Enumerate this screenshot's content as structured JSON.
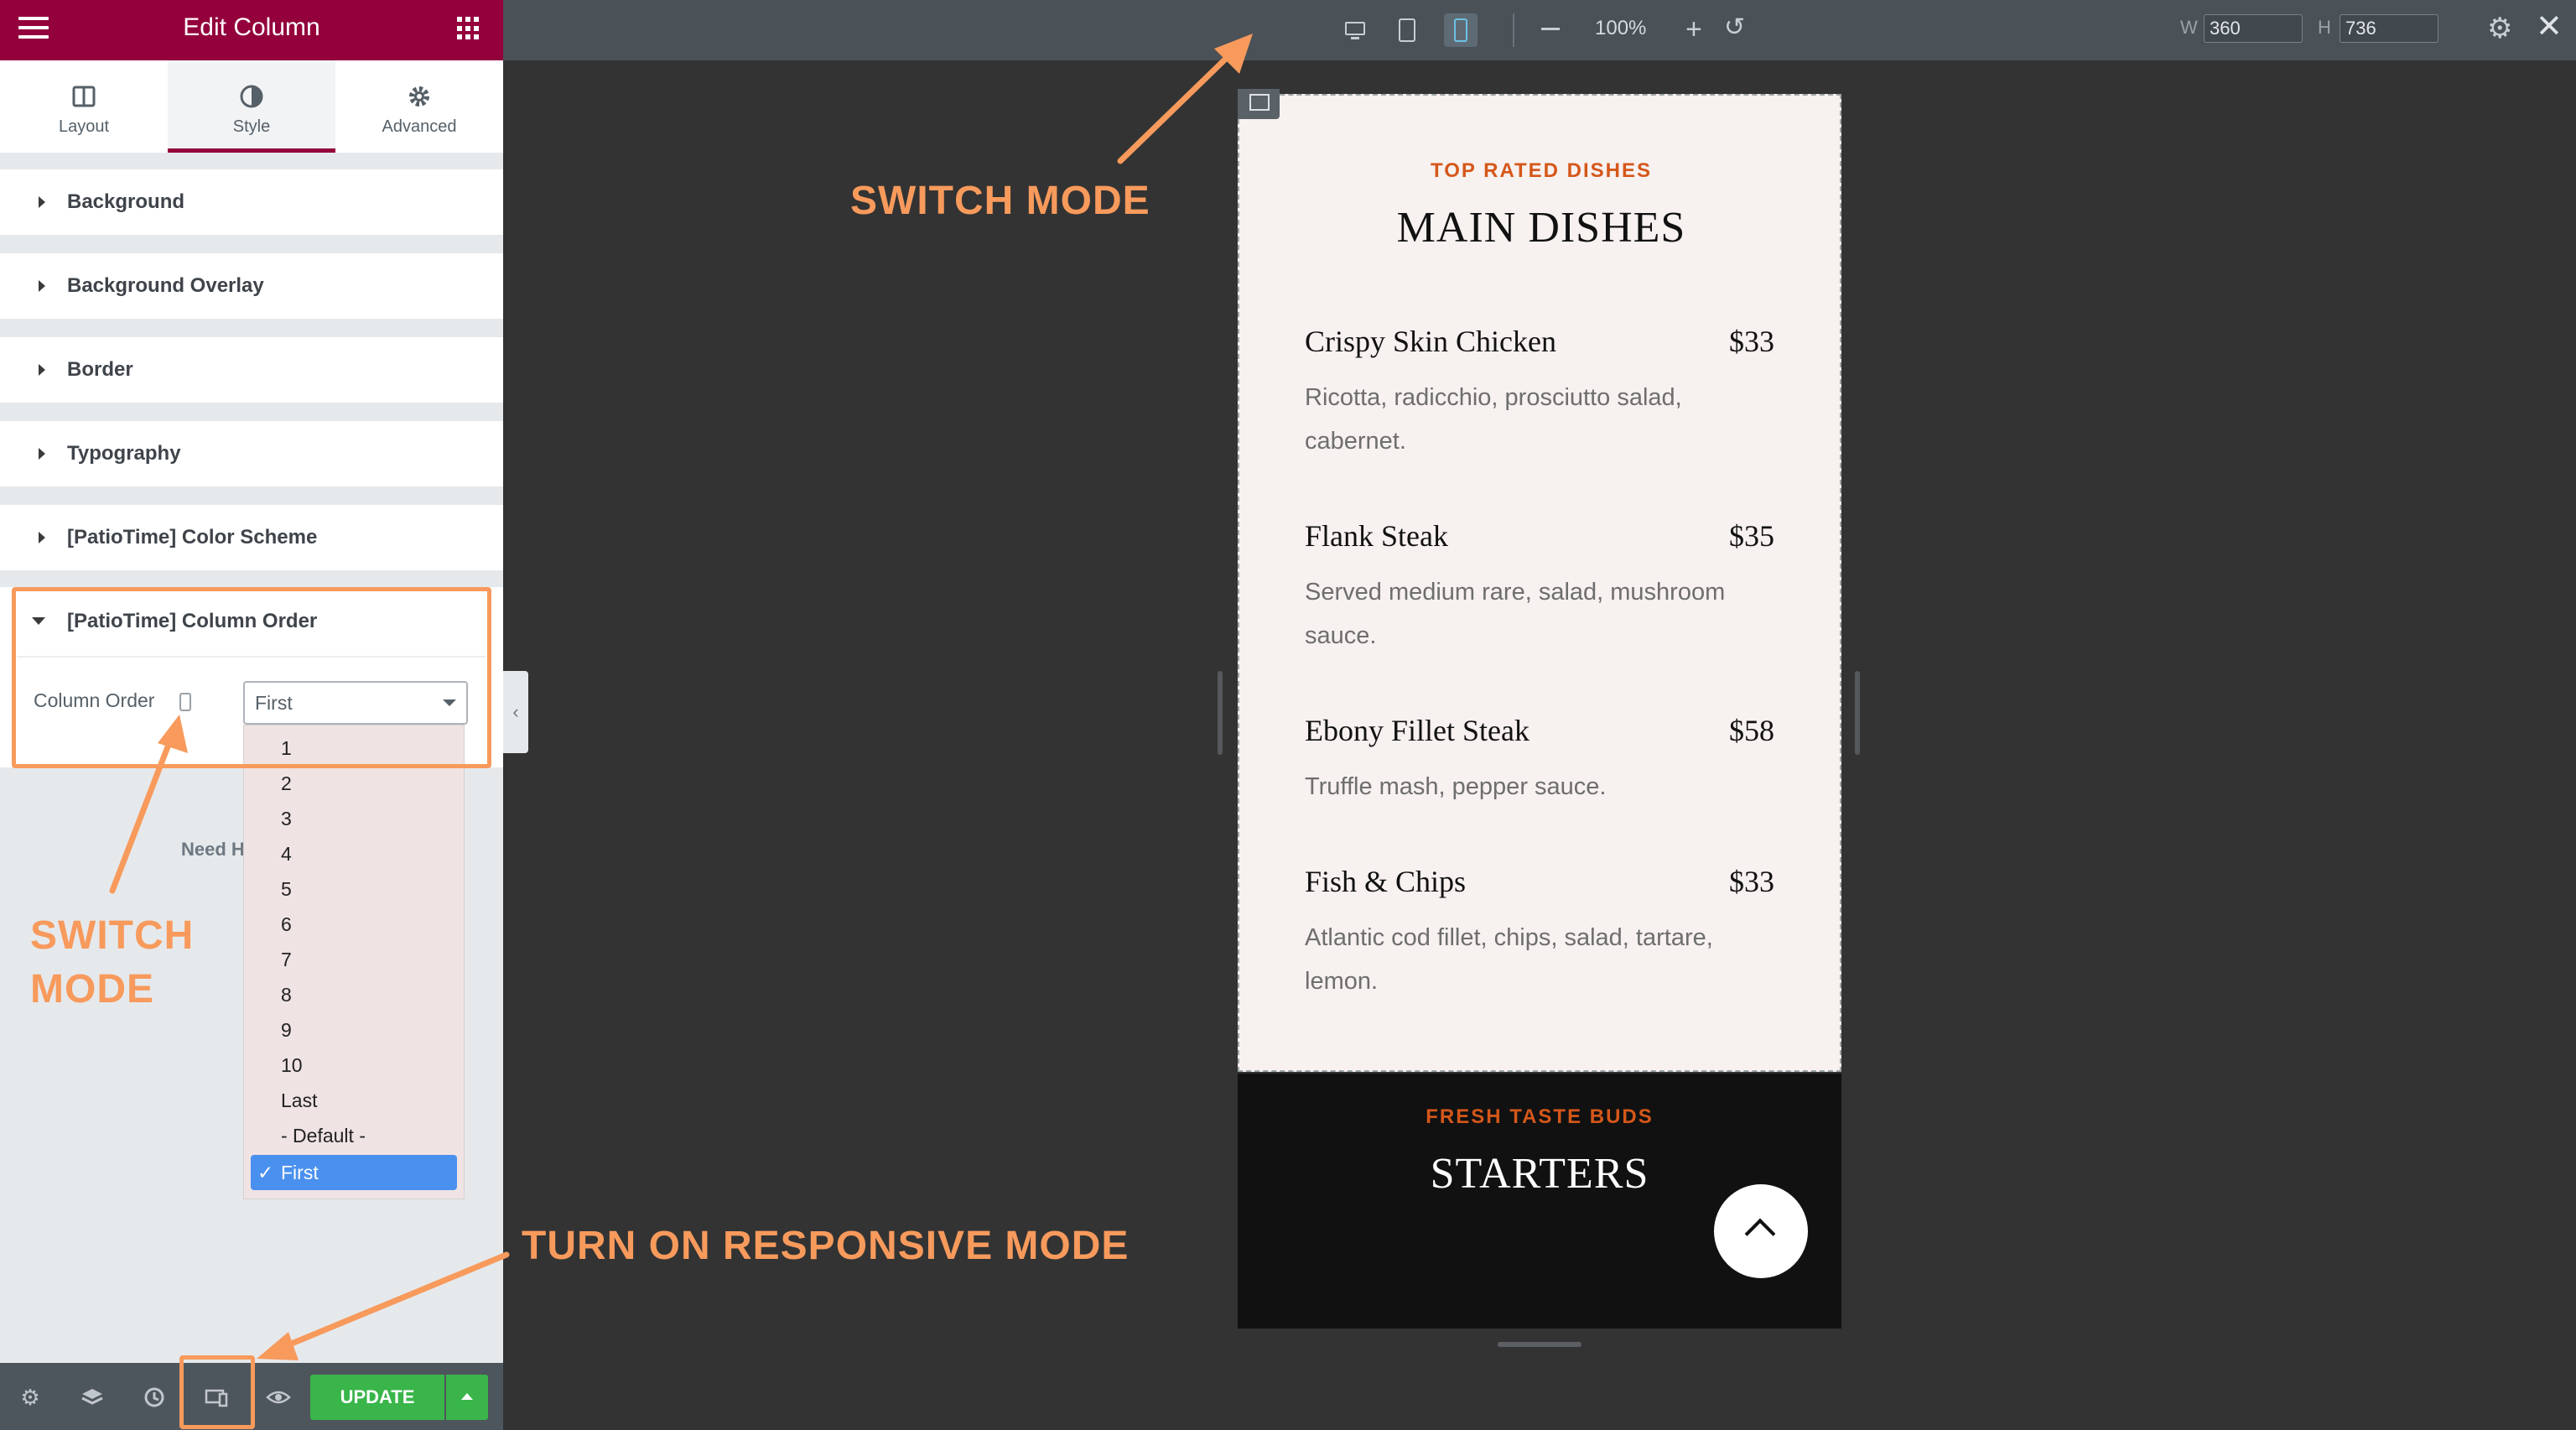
{
  "panel": {
    "title": "Edit Column",
    "tabs": [
      {
        "label": "Layout",
        "icon": "columns-icon"
      },
      {
        "label": "Style",
        "icon": "contrast-icon"
      },
      {
        "label": "Advanced",
        "icon": "gear-icon"
      }
    ],
    "active_tab": "Style",
    "sections": [
      {
        "label": "Background"
      },
      {
        "label": "Background Overlay"
      },
      {
        "label": "Border"
      },
      {
        "label": "Typography"
      },
      {
        "label": "[PatioTime] Color Scheme"
      }
    ],
    "open_section": {
      "label": "[PatioTime] Column Order",
      "field_label": "Column Order",
      "selected": "First"
    },
    "need_help": "Need H",
    "dropdown_options": [
      "1",
      "2",
      "3",
      "4",
      "5",
      "6",
      "7",
      "8",
      "9",
      "10",
      "Last",
      "- Default -",
      "First"
    ],
    "update_label": "UPDATE",
    "accent_color": "#93003c"
  },
  "toolbar": {
    "zoom": "100%",
    "width_label": "W",
    "width_value": "360",
    "height_label": "H",
    "height_value": "736",
    "active_device": "mobile"
  },
  "preview": {
    "kicker": "TOP RATED DISHES",
    "heading": "MAIN DISHES",
    "dishes": [
      {
        "name": "Crispy Skin Chicken",
        "price": "$33",
        "desc": "Ricotta, radicchio, prosciutto salad, cabernet."
      },
      {
        "name": "Flank Steak",
        "price": "$35",
        "desc": "Served medium rare, salad, mushroom sauce."
      },
      {
        "name": "Ebony Fillet Steak",
        "price": "$58",
        "desc": "Truffle mash, pepper sauce."
      },
      {
        "name": "Fish & Chips",
        "price": "$33",
        "desc": "Atlantic cod fillet, chips, salad, tartare, lemon."
      }
    ],
    "starters_kicker": "FRESH TASTE BUDS",
    "starters_heading": "STARTERS"
  },
  "annotations": {
    "switch_mode_top": "SWITCH MODE",
    "switch_mode_left_1": "SWITCH",
    "switch_mode_left_2": "MODE",
    "turn_on": "TURN ON RESPONSIVE MODE",
    "color": "#f79a5c"
  }
}
